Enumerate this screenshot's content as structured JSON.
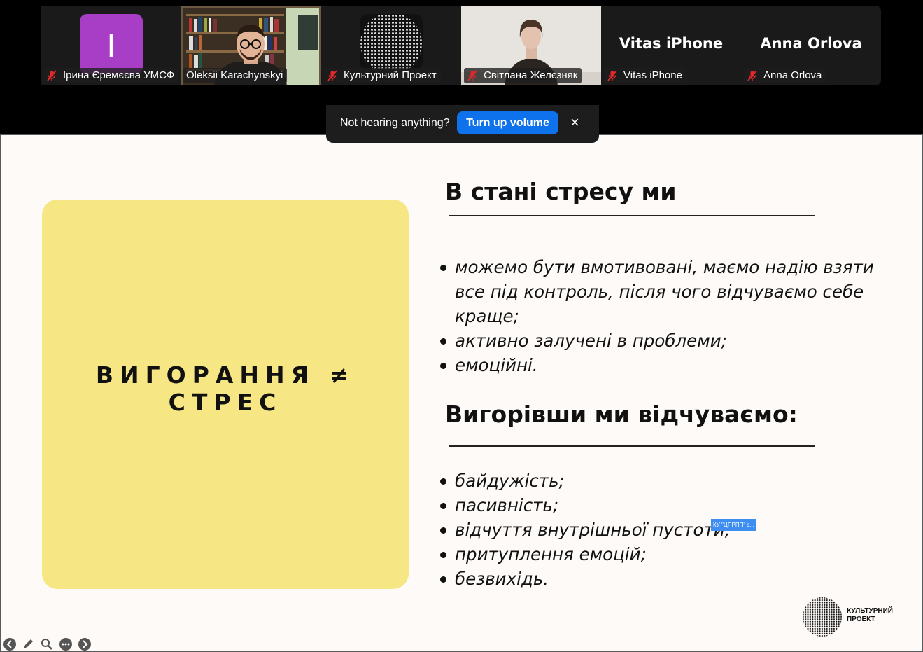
{
  "participants": [
    {
      "name": "Ірина Єремєєва УМСФ",
      "avatar_letter": "I",
      "muted": true,
      "video": false
    },
    {
      "name": "Oleksii Karachynskyi",
      "muted": false,
      "video": true,
      "active_speaker": true
    },
    {
      "name": "Культурний Проект",
      "muted": true,
      "video": false,
      "avatar": "dot-sphere-logo"
    },
    {
      "name": "Світлана Желєзняк",
      "muted": true,
      "video": true
    },
    {
      "name": "Vitas iPhone",
      "display_title": "Vitas iPhone",
      "muted": true,
      "video": false
    },
    {
      "name": "Anna Orlova",
      "display_title": "Anna Orlova",
      "muted": true,
      "video": false
    }
  ],
  "audio_notice": {
    "message": "Not hearing anything?",
    "button_label": "Turn up volume",
    "close_symbol": "×"
  },
  "slide": {
    "card_title": "ВИГОРАННЯ ≠ СТРЕС",
    "section1": {
      "heading": "В стані стресу ми",
      "bullets": [
        "можемо бути вмотивовані, маємо надію взяти все під контроль, після чого відчуваємо себе краще;",
        "активно залучені в проблеми;",
        "емоційні."
      ]
    },
    "section2": {
      "heading": "Вигорівши ми відчуваємо:",
      "bullets": [
        "байдужість;",
        "пасивність;",
        "відчуття внутрішньої пустоти;",
        "притуплення емоцій;",
        "безвихідь."
      ]
    },
    "overlay_label": "КУ \"ЦПРПП\" з...",
    "logo_line1": "КУЛЬТУРНИЙ",
    "logo_line2": "ПРОЕКТ"
  },
  "annotation_toolbar": [
    "back-arrow-icon",
    "pen-icon",
    "zoom-icon",
    "more-icon",
    "forward-arrow-icon"
  ],
  "colors": {
    "accent_blue": "#0e72ed",
    "active_speaker": "#23d959",
    "card_yellow": "#f7e784",
    "avatar_purple": "#a93ec6",
    "mute_red": "#e02828"
  }
}
